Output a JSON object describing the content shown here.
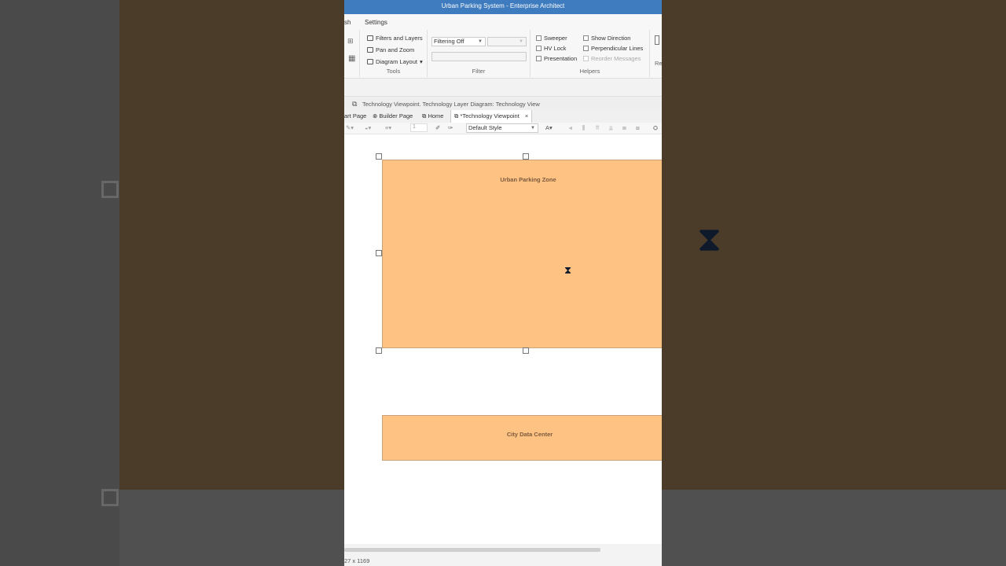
{
  "window": {
    "title": "Urban Parking System - Enterprise Architect"
  },
  "menu": {
    "items": [
      "sh",
      "Settings"
    ]
  },
  "ribbon": {
    "tools": {
      "label": "Tools",
      "items": [
        "Filters and Layers",
        "Pan and Zoom",
        "Diagram Layout"
      ]
    },
    "filter": {
      "label": "Filter",
      "dropdown_value": "Filtering Off"
    },
    "helpers": {
      "label": "Helpers",
      "checkboxes": [
        "Sweeper",
        "HV Lock",
        "Presentation",
        "Show Direction",
        "Perpendicular Lines",
        "Reorder Messages"
      ]
    },
    "next_group_partial": "Re"
  },
  "breadcrumb": "Technology Viewpoint.  Technology Layer Diagram: Technology View",
  "tabs": [
    "art Page",
    "Builder Page",
    "Home",
    "*Technology Viewpoint"
  ],
  "tab_close": "×",
  "diagram_toolbar": {
    "line_width": "1",
    "style": "Default Style"
  },
  "diagram": {
    "elements": [
      {
        "name": "Urban Parking Zone",
        "selected": true
      },
      {
        "name": "City Data Center",
        "selected": false
      }
    ]
  },
  "status": {
    "size": "27 x 1169"
  },
  "colors": {
    "title_bar": "#3e7bbf",
    "element_fill": "#fec283",
    "element_label": "#7a5a3e"
  }
}
